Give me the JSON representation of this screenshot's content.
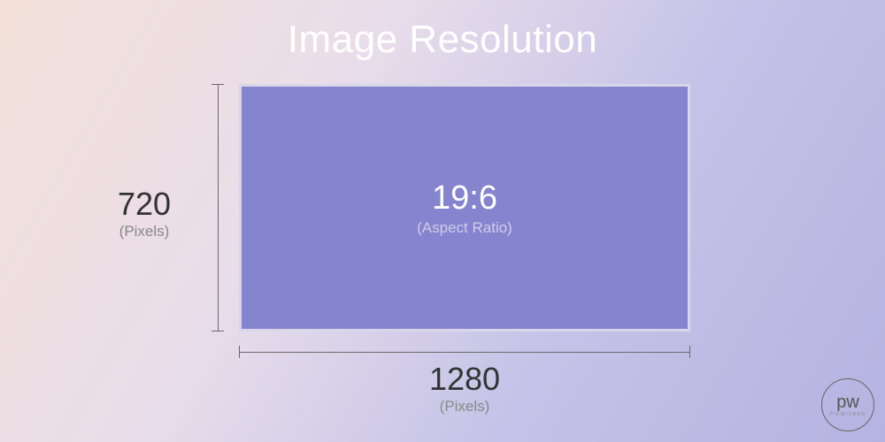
{
  "title": "Image Resolution",
  "box": {
    "aspect_ratio_value": "19:6",
    "aspect_ratio_label": "(Aspect Ratio)"
  },
  "height": {
    "value": "720",
    "unit": "(Pixels)"
  },
  "width": {
    "value": "1280",
    "unit": "(Pixels)"
  },
  "watermark": {
    "main": "pw",
    "sub": "PIKWIZARD"
  }
}
